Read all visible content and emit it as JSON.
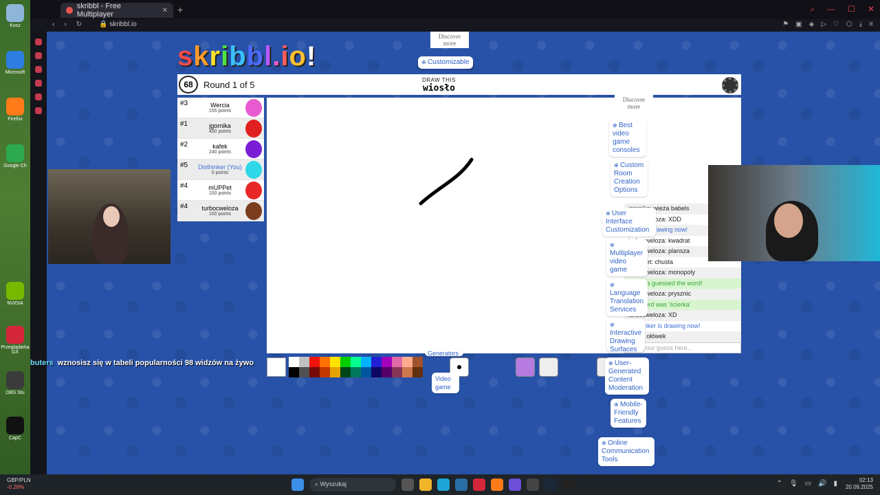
{
  "desktop": {
    "icons": [
      {
        "label": "Kosz",
        "color": "#8fb5d8"
      },
      {
        "label": "Microsoft",
        "color": "#2e7de1"
      },
      {
        "label": "Firefox",
        "color": "#ff7b1a"
      },
      {
        "label": "Google Ch",
        "color": "#2da94f"
      },
      {
        "label": "NVIDIA",
        "color": "#76b900"
      },
      {
        "label": "Przeglądarka GX",
        "color": "#d6263b"
      },
      {
        "label": "OBS Stu",
        "color": "#3b3b3b"
      },
      {
        "label": "CapC",
        "color": "#111111"
      }
    ]
  },
  "browser": {
    "tab_title": "skribbl - Free Multiplayer",
    "url": "skribbl.io"
  },
  "game": {
    "logo": "skribbl.io",
    "timer": "68",
    "round": "Round 1 of 5",
    "draw_this": "DRAW THIS",
    "word": "wiosło",
    "players": [
      {
        "rank": "#3",
        "name": "Wercia",
        "points": "155 points",
        "color": "#e85bd0",
        "me": false
      },
      {
        "rank": "#1",
        "name": "jgornika",
        "points": "400 points",
        "color": "#e02020",
        "me": false
      },
      {
        "rank": "#2",
        "name": "kafek",
        "points": "240 points",
        "color": "#7a1ed6",
        "me": false
      },
      {
        "rank": "#5",
        "name": "Disthinker (You)",
        "points": "0 points",
        "color": "#2fd7e8",
        "me": true
      },
      {
        "rank": "#4",
        "name": "mUPPet",
        "points": "100 points",
        "color": "#e82828",
        "me": false
      },
      {
        "rank": "#4",
        "name": "turbocweloza",
        "points": "100 points",
        "color": "#7a3d1e",
        "me": false
      }
    ],
    "chat": [
      {
        "text": "jgornika: wieża babels",
        "kind": "normal"
      },
      {
        "text": "turbocweloza: XDD",
        "kind": "normal"
      },
      {
        "text": "kafek is drawing now!",
        "kind": "blue"
      },
      {
        "text": "turbocweloza: kwadrat",
        "kind": "normal"
      },
      {
        "text": "turbocweloza: plansza",
        "kind": "normal"
      },
      {
        "text": "mUPPet: chusta",
        "kind": "normal"
      },
      {
        "text": "turbocweloza: monopoly",
        "kind": "normal"
      },
      {
        "text": "jgornika guessed the word!",
        "kind": "green"
      },
      {
        "text": "turbocweloza: prysznic",
        "kind": "normal"
      },
      {
        "text": "The word was 'ścierka'",
        "kind": "green"
      },
      {
        "text": "turbocweloza: XD",
        "kind": "normal"
      },
      {
        "text": "Disthinker is drawing now!",
        "kind": "blue"
      },
      {
        "text": "kafka: ołówek",
        "kind": "normal"
      }
    ],
    "guess_placeholder": "Type your guess here...",
    "palette": [
      "#ffffff",
      "#c1c1c1",
      "#ef130b",
      "#ff7100",
      "#ffe400",
      "#00cc00",
      "#00ff91",
      "#00b2ff",
      "#231fd3",
      "#a300ba",
      "#df69a7",
      "#ffac8e",
      "#a0522d",
      "#000000",
      "#505050",
      "#740b07",
      "#c23800",
      "#e8a200",
      "#004619",
      "#00785d",
      "#00569e",
      "#0e0865",
      "#550069",
      "#873554",
      "#cc774d",
      "#63300d"
    ]
  },
  "ads": {
    "discover": "Discover more",
    "items": [
      "Customizable",
      "Best video game consoles",
      "Custom Room Creation Options",
      "User Interface Customization",
      "Multiplayer video game",
      "Language Translation Services",
      "Interactive Drawing Surfaces",
      "User-Generated Content Moderation",
      "Mobile-Friendly Features",
      "Online Communication Tools",
      "Generators",
      "Video game"
    ]
  },
  "stream": {
    "user": "buters",
    "message": "wznosisz się w tabeli popularności 98 widzów na żywo"
  },
  "taskbar": {
    "ticker": "GBP/PLN",
    "change": "-0.28%",
    "search": "Wyszukaj",
    "time": "02:13",
    "date": "20.09.2025"
  }
}
